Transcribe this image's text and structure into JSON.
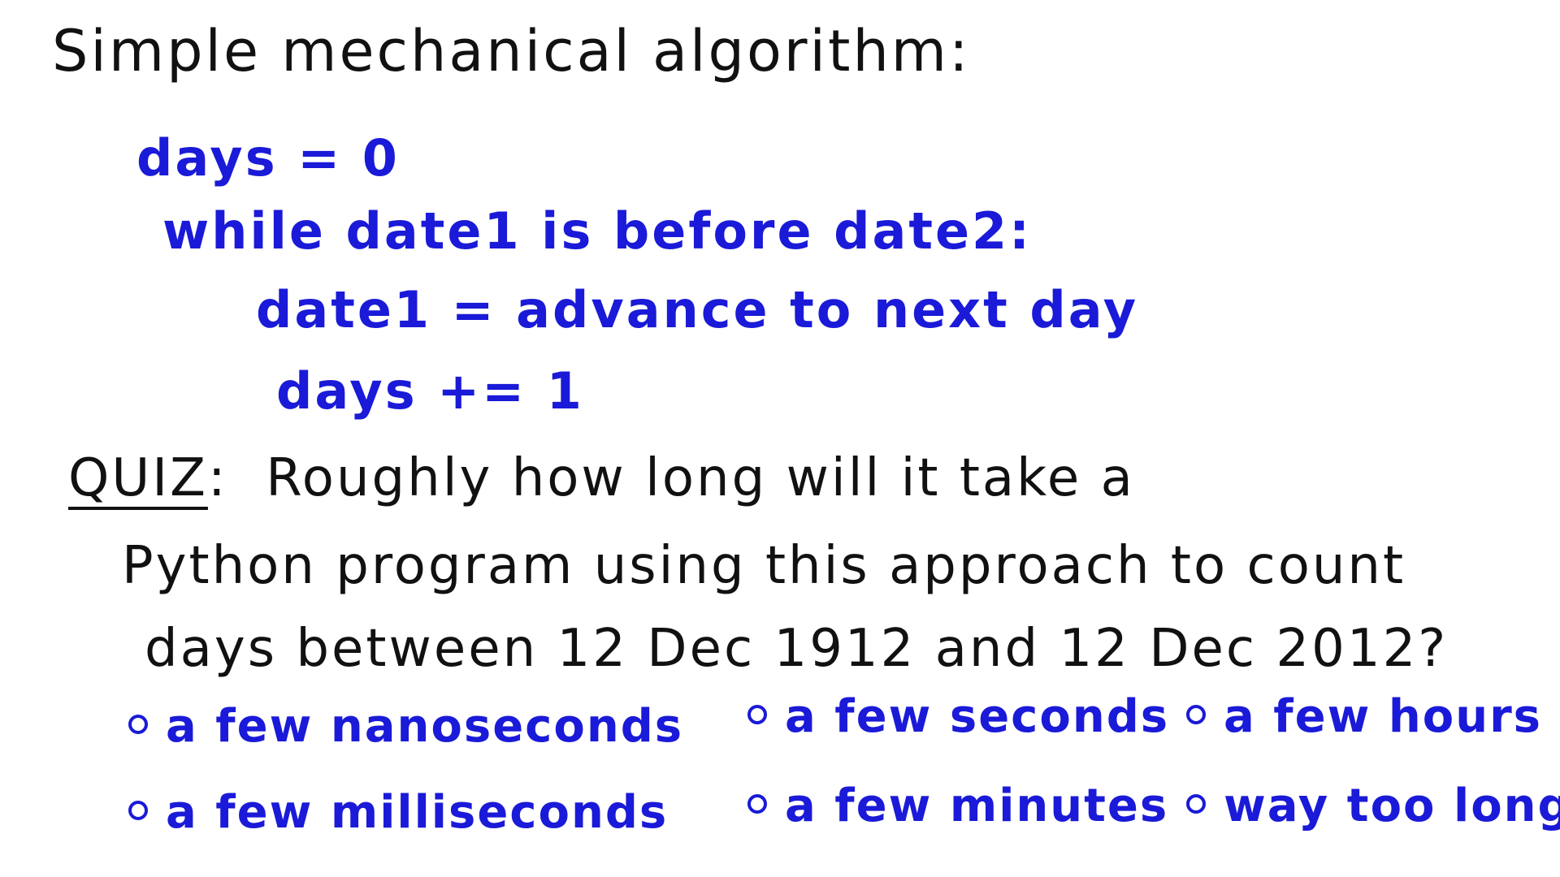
{
  "title": "Simple mechanical algorithm:",
  "code": [
    "days = 0",
    "while date1 is before date2:",
    "date1 = advance to next day",
    "days += 1"
  ],
  "quiz": {
    "label": "QUIZ",
    "separator": ":",
    "question_line1": "Roughly how long will it take a",
    "question_line2": "Python program using this approach to count",
    "question_line3": "days between 12 Dec 1912 and 12 Dec 2012?"
  },
  "options": [
    "a few nanoseconds",
    "a few seconds",
    "a few hours",
    "a few milliseconds",
    "a few minutes",
    "way too long!"
  ],
  "colors": {
    "black_ink": "#111111",
    "blue_ink": "#1a1ad8",
    "background": "#ffffff"
  }
}
